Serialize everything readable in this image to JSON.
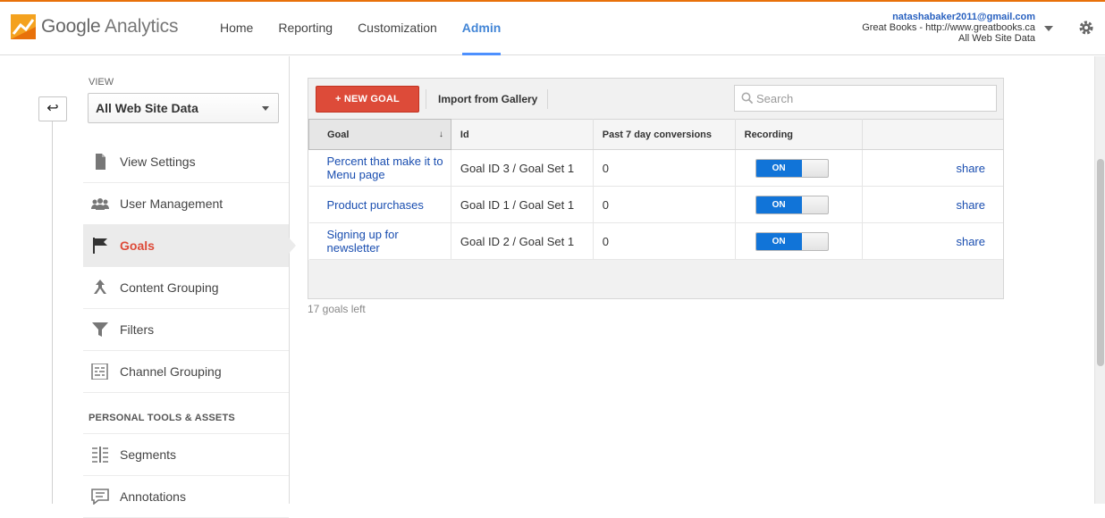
{
  "app": {
    "brand_google": "Google",
    "brand_product": "Analytics"
  },
  "nav": {
    "items": [
      {
        "label": "Home"
      },
      {
        "label": "Reporting"
      },
      {
        "label": "Customization"
      },
      {
        "label": "Admin",
        "active": true
      }
    ]
  },
  "account": {
    "email": "natashabaker2011@gmail.com",
    "property": "Great Books - http://www.greatbooks.ca",
    "view": "All Web Site Data"
  },
  "sidebar": {
    "view_label": "VIEW",
    "view_selected": "All Web Site Data",
    "items": [
      {
        "label": "View Settings",
        "icon": "document-icon"
      },
      {
        "label": "User Management",
        "icon": "users-icon"
      },
      {
        "label": "Goals",
        "icon": "flag-icon",
        "active": true
      },
      {
        "label": "Content Grouping",
        "icon": "grouping-icon"
      },
      {
        "label": "Filters",
        "icon": "funnel-icon"
      },
      {
        "label": "Channel Grouping",
        "icon": "channel-icon"
      }
    ],
    "section_heading": "PERSONAL TOOLS & ASSETS",
    "section_items": [
      {
        "label": "Segments",
        "icon": "segments-icon"
      },
      {
        "label": "Annotations",
        "icon": "annotation-icon"
      }
    ]
  },
  "toolbar": {
    "new_goal_label": "+ NEW GOAL",
    "import_label": "Import from Gallery",
    "search_placeholder": "Search"
  },
  "table": {
    "columns": [
      "Goal",
      "Id",
      "Past 7 day conversions",
      "Recording",
      ""
    ],
    "rows": [
      {
        "goal": "Percent that make it to Menu page",
        "id": "Goal ID 3 / Goal Set 1",
        "conversions": "0",
        "recording": "ON",
        "action": "share"
      },
      {
        "goal": "Product purchases",
        "id": "Goal ID 1 / Goal Set 1",
        "conversions": "0",
        "recording": "ON",
        "action": "share"
      },
      {
        "goal": "Signing up for newsletter",
        "id": "Goal ID 2 / Goal Set 1",
        "conversions": "0",
        "recording": "ON",
        "action": "share"
      }
    ]
  },
  "footer": {
    "goals_left": "17 goals left"
  },
  "colors": {
    "accent_orange": "#e8710a",
    "admin_blue": "#4285d6",
    "new_goal_red": "#dd4b39",
    "toggle_blue": "#1174d8",
    "link_blue": "#1a4eb0"
  }
}
